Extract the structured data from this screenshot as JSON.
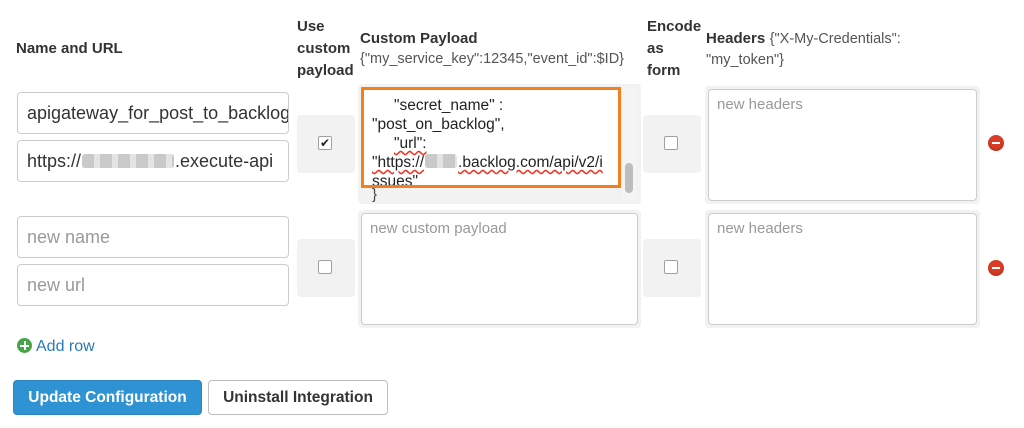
{
  "header": {
    "name_and_url": "Name and URL",
    "use_custom_payload": [
      "Use",
      "custom",
      "payload"
    ],
    "custom_payload": "Custom Payload",
    "custom_payload_example": "{\"my_service_key\":12345,\"event_id\":$ID}",
    "encode_as_form": [
      "Encode",
      "as",
      "form"
    ],
    "headers": "Headers",
    "headers_example_1": "{\"X-My-Credentials\":",
    "headers_example_2": "\"my_token\"}"
  },
  "rows": [
    {
      "name_value": "apigateway_for_post_to_backlog",
      "url_prefix": "https://",
      "url_suffix": ".execute-api",
      "use_custom_payload": true,
      "payload_lines": {
        "l1": "\"secret_name\" :",
        "l2": "\"post_on_backlog\",",
        "l3": "\"url\":",
        "l4_prefix": "\"https://",
        "l4_suffix": ".backlog.com/api/v2/i",
        "l5": "ssues\"",
        "closing": "}"
      },
      "encode_as_form": false,
      "headers_placeholder": "new headers"
    },
    {
      "name_placeholder": "new name",
      "url_placeholder": "new url",
      "use_custom_payload": false,
      "payload_placeholder": "new custom payload",
      "encode_as_form": false,
      "headers_placeholder": "new headers"
    }
  ],
  "actions": {
    "add_row": "Add row",
    "update": "Update Configuration",
    "uninstall": "Uninstall Integration"
  },
  "colors": {
    "highlight_border": "#f47f1e",
    "primary_button": "#2f93d3",
    "remove_icon": "#d83c24",
    "add_icon": "#48a448",
    "link": "#2a7ab8"
  },
  "icons": {
    "remove": "minus-circle-icon",
    "add": "plus-circle-icon",
    "check": "checkmark-icon"
  }
}
